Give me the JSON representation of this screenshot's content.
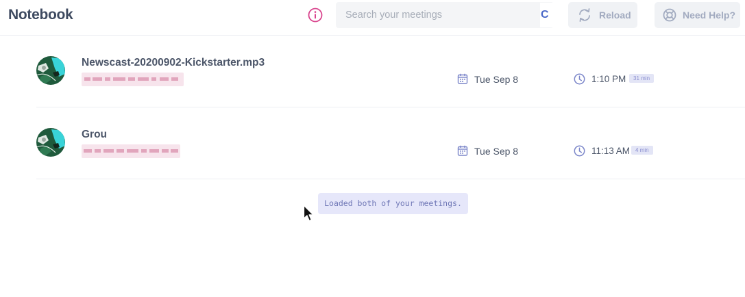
{
  "header": {
    "title": "Notebook",
    "info_icon": "info-circle-icon",
    "search": {
      "placeholder": "Search your meetings",
      "value": "",
      "trailing_glyph": "C"
    },
    "reload_label": "Reload",
    "help_label": "Need Help?"
  },
  "meetings": [
    {
      "title": "Newscast-20200902-Kickstarter.mp3",
      "date": "Tue Sep 8",
      "time": "1:10 PM",
      "duration": "31 min"
    },
    {
      "title": "Grou",
      "date": "Tue Sep 8",
      "time": "11:13 AM",
      "duration": "4 min"
    }
  ],
  "toast": "Loaded both of your meetings.",
  "colors": {
    "accent": "#4a68c8",
    "info_pink": "#d9458e",
    "muted_button_text": "#a2abc0",
    "badge_bg": "#e3e5f6",
    "toast_bg": "#e6e7fa"
  }
}
